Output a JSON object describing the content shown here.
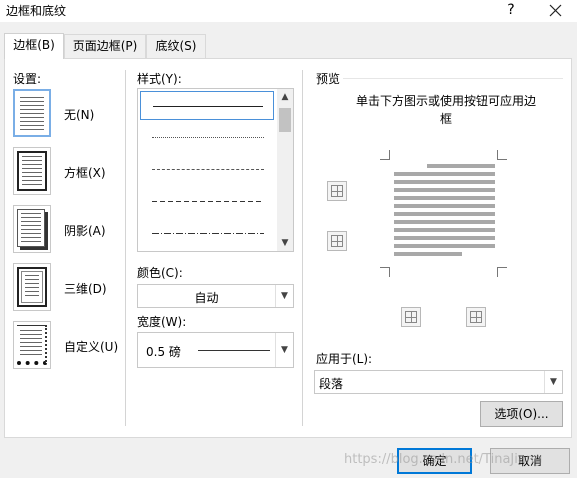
{
  "window": {
    "title": "边框和底纹",
    "help": "?"
  },
  "tabs": [
    {
      "label": "边框(B)",
      "active": true
    },
    {
      "label": "页面边框(P)",
      "active": false
    },
    {
      "label": "底纹(S)",
      "active": false
    }
  ],
  "settings": {
    "label": "设置:",
    "items": [
      {
        "label": "无(N)",
        "icon": "setting-none-icon",
        "selected": true
      },
      {
        "label": "方框(X)",
        "icon": "setting-box-icon",
        "selected": false
      },
      {
        "label": "阴影(A)",
        "icon": "setting-shadow-icon",
        "selected": false
      },
      {
        "label": "三维(D)",
        "icon": "setting-3d-icon",
        "selected": false
      },
      {
        "label": "自定义(U)",
        "icon": "setting-custom-icon",
        "selected": false
      }
    ]
  },
  "style": {
    "label": "样式(Y):",
    "items": [
      "solid",
      "dotted",
      "dash-dot-small",
      "dashed",
      "dash-dot",
      "dash-dot-dot"
    ],
    "selected_index": 0
  },
  "color": {
    "label": "颜色(C):",
    "value": "自动"
  },
  "width": {
    "label": "宽度(W):",
    "value": "0.5 磅"
  },
  "preview": {
    "label": "预览",
    "instructions": "单击下方图示或使用按钮可应用边框"
  },
  "apply_to": {
    "label": "应用于(L):",
    "value": "段落"
  },
  "buttons": {
    "options": "选项(O)...",
    "ok": "确定",
    "cancel": "取消"
  },
  "watermark": "https://blog.csdn.net/TinaJiang",
  "colors": {
    "accent": "#0078d7",
    "selection": "#7aaee6",
    "panel": "#ffffff",
    "background": "#f0f0f0"
  }
}
